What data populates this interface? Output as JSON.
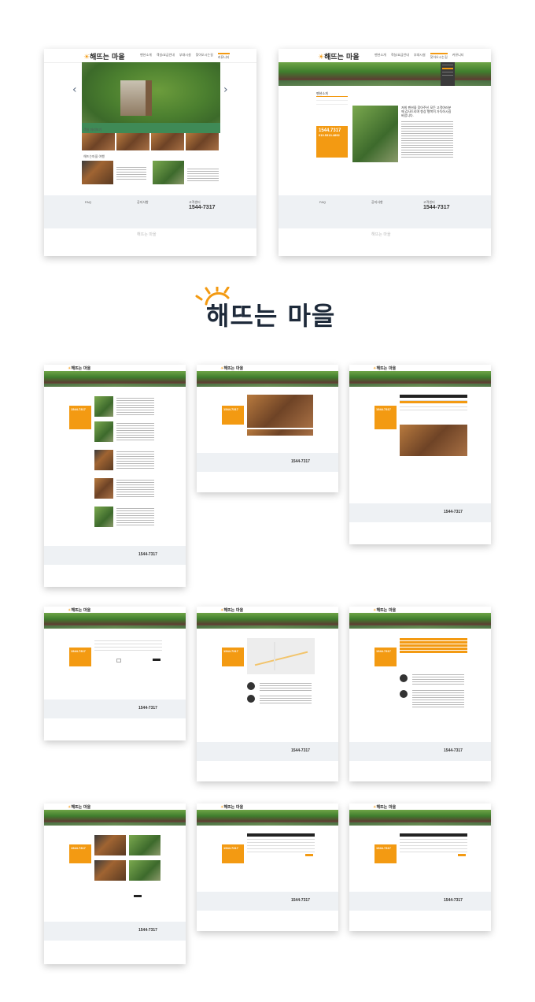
{
  "title": {
    "name": "해뜨는 마을"
  },
  "site": {
    "logo": "해뜨는 마을",
    "menu": [
      "펜션소개",
      "객실/요금안내",
      "부대시설",
      "찾아오시는길",
      "커뮤니티"
    ],
    "phone": "1544-7317",
    "phone_alt": "1544.7317",
    "phone_sub": "010.5313.4892",
    "footer_faq": "FAQ",
    "footer_notice": "공지사항",
    "footer_center": "고객센터",
    "footer_btn": "실시간 예약 바로가기",
    "sig": "해뜨는 마을"
  },
  "pages": {
    "main": {
      "section_rooms": "객실 미리보기",
      "section_gallery": "해뜨는마을 여행",
      "arrow_left": "‹",
      "arrow_right": "›"
    },
    "intro": {
      "tab": "펜션소개",
      "headline": "저희 펜션을 찾아주신 모든 고객여러분께 감사드리며 항상 행복이 가득하시길 바랍니다."
    }
  },
  "colors": {
    "accent": "#f39a12",
    "dark": "#2a2a2a",
    "footer_bg": "#eef1f4"
  }
}
